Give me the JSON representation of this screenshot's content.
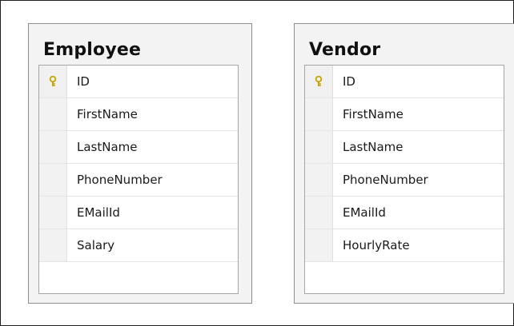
{
  "tables": [
    {
      "title": "Employee",
      "columns": [
        {
          "label": "ID",
          "is_primary_key": true,
          "icon": "key-icon"
        },
        {
          "label": "FirstName",
          "is_primary_key": false
        },
        {
          "label": "LastName",
          "is_primary_key": false
        },
        {
          "label": "PhoneNumber",
          "is_primary_key": false
        },
        {
          "label": "EMailId",
          "is_primary_key": false
        },
        {
          "label": "Salary",
          "is_primary_key": false
        }
      ]
    },
    {
      "title": "Vendor",
      "columns": [
        {
          "label": "ID",
          "is_primary_key": true,
          "icon": "key-icon"
        },
        {
          "label": "FirstName",
          "is_primary_key": false
        },
        {
          "label": "LastName",
          "is_primary_key": false
        },
        {
          "label": "PhoneNumber",
          "is_primary_key": false
        },
        {
          "label": "EMailId",
          "is_primary_key": false
        },
        {
          "label": "HourlyRate",
          "is_primary_key": false
        }
      ]
    }
  ],
  "colors": {
    "key_icon": "#c9a400",
    "table_background": "#f3f3f3",
    "border": "#8d8d8d"
  }
}
